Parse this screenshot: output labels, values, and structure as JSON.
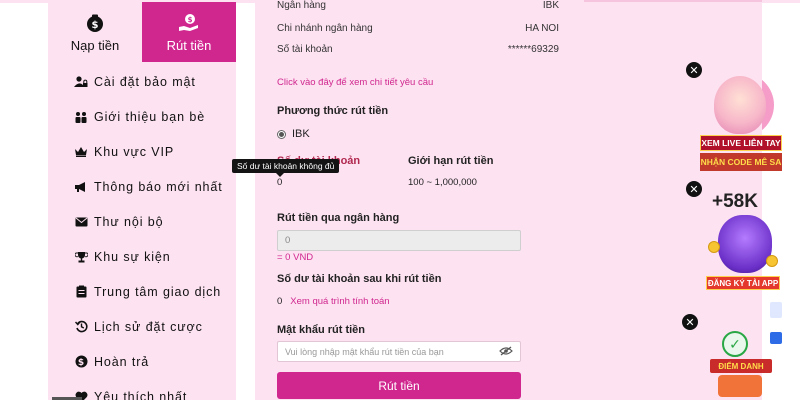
{
  "tabs": {
    "deposit_label": "Nạp tiền",
    "withdraw_label": "Rút tiền"
  },
  "sidebar": {
    "items": [
      {
        "label": "Cài đặt bảo mật",
        "icon": "user-lock-icon"
      },
      {
        "label": "Giới thiệu bạn bè",
        "icon": "people-icon"
      },
      {
        "label": "Khu vực VIP",
        "icon": "crown-icon"
      },
      {
        "label": "Thông báo mới nhất",
        "icon": "megaphone-icon"
      },
      {
        "label": "Thư nội bộ",
        "icon": "envelope-icon"
      },
      {
        "label": "Khu sự kiện",
        "icon": "trophy-icon"
      },
      {
        "label": "Trung tâm giao dịch",
        "icon": "clipboard-icon"
      },
      {
        "label": "Lịch sử đặt cược",
        "icon": "history-icon"
      },
      {
        "label": "Hoàn trả",
        "icon": "dollar-coin-icon"
      },
      {
        "label": "Yêu thích nhất",
        "icon": "heart-icon"
      }
    ]
  },
  "bank_info": {
    "bank_label": "Ngân hàng",
    "bank_value": "IBK",
    "branch_label": "Chi nhánh ngân hàng",
    "branch_value": "HA NOI",
    "account_label": "Số tài khoản",
    "account_value": "******69329",
    "details_link": "Click vào đây để xem chi tiết yêu cầu"
  },
  "method": {
    "title": "Phương thức rút tiền",
    "option": "IBK"
  },
  "balance": {
    "label": "Số dư tài khoản",
    "value": "0",
    "limit_label": "Giới hạn rút tiền",
    "limit_value": "100 ~ 1,000,000",
    "tooltip": "Số dư tài khoản không đủ"
  },
  "withdraw_bank": {
    "title": "Rút tiền qua ngân hàng",
    "amount_value": "0",
    "vnd_note": "= 0 VND"
  },
  "after_balance": {
    "title": "Số dư tài khoản sau khi rút tiền",
    "value": "0",
    "calc_link": "Xem quá trình tính toán"
  },
  "password": {
    "title": "Mật khẩu rút tiền",
    "placeholder": "Vui lòng nhập mật khẩu rút tiền của bạn"
  },
  "submit_label": "Rút tiền",
  "promos": {
    "live_line1": "XEM LIVE LIÊN TAY",
    "live_line2": "NHẬN CODE MÊ SA",
    "bonus_amount": "+58K",
    "app_label": "ĐĂNG KÝ TẢI APP",
    "checkin_label": "ĐIỂM DANH"
  },
  "colors": {
    "brand_pink": "#d0278f",
    "panel_bg": "#fde2f1"
  }
}
